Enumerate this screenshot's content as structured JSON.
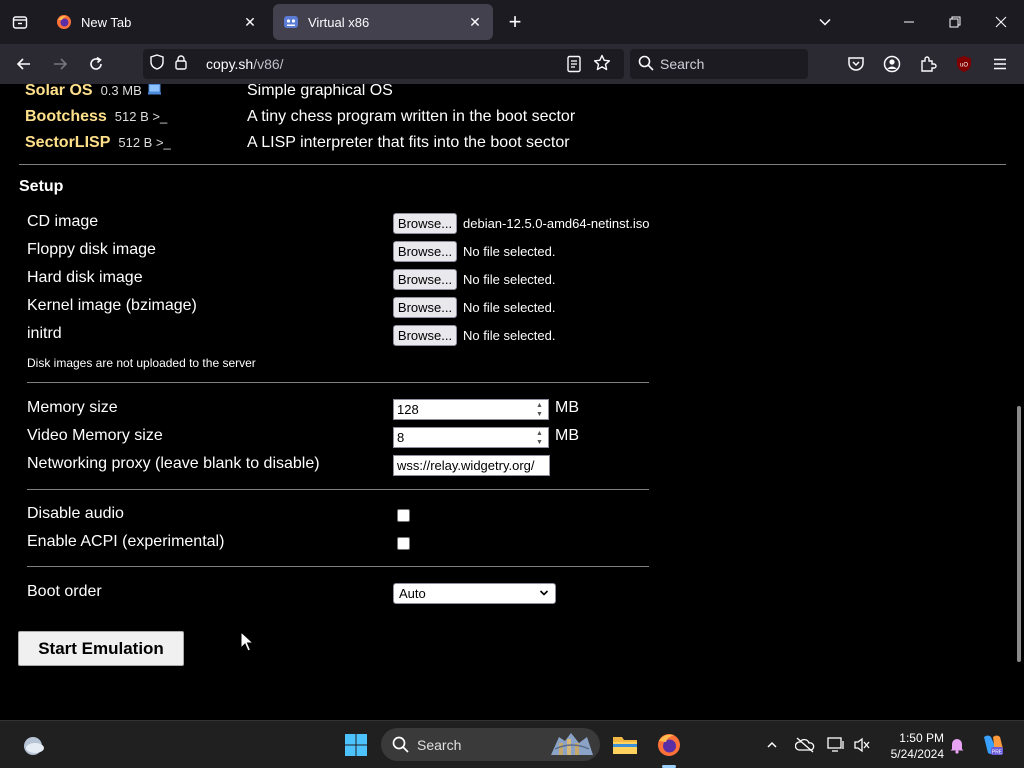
{
  "browser": {
    "tabs": [
      {
        "title": "New Tab",
        "active": false
      },
      {
        "title": "Virtual x86",
        "active": true
      }
    ],
    "url": {
      "host": "copy.sh",
      "path": "/v86/"
    },
    "search_placeholder": "Search"
  },
  "os_list": [
    {
      "name": "Solar OS",
      "size": "0.3 MB",
      "desc": "Simple graphical OS"
    },
    {
      "name": "Bootchess",
      "size": "512 B >_",
      "desc": "A tiny chess program written in the boot sector"
    },
    {
      "name": "SectorLISP",
      "size": "512 B >_",
      "desc": "A LISP interpreter that fits into the boot sector"
    }
  ],
  "setup": {
    "title": "Setup",
    "files": [
      {
        "label": "CD image",
        "button": "Browse...",
        "status": "debian-12.5.0-amd64-netinst.iso"
      },
      {
        "label": "Floppy disk image",
        "button": "Browse...",
        "status": "No file selected."
      },
      {
        "label": "Hard disk image",
        "button": "Browse...",
        "status": "No file selected."
      },
      {
        "label": "Kernel image (bzimage)",
        "button": "Browse...",
        "status": "No file selected."
      },
      {
        "label": "initrd",
        "button": "Browse...",
        "status": "No file selected."
      }
    ],
    "note": "Disk images are not uploaded to the server",
    "memory_label": "Memory size",
    "memory_value": "128",
    "memory_unit": "MB",
    "vram_label": "Video Memory size",
    "vram_value": "8",
    "vram_unit": "MB",
    "proxy_label": "Networking proxy (leave blank to disable)",
    "proxy_value": "wss://relay.widgetry.org/",
    "disable_audio_label": "Disable audio",
    "disable_audio_checked": false,
    "acpi_label": "Enable ACPI (experimental)",
    "acpi_checked": false,
    "boot_order_label": "Boot order",
    "boot_order_value": "Auto",
    "start_button": "Start Emulation"
  },
  "taskbar": {
    "search_label": "Search",
    "time": "1:50 PM",
    "date": "5/24/2024"
  },
  "colors": {
    "os_name": "#ffe08a",
    "tab_active": "#42414d",
    "chrome_bg": "#1c1b22",
    "taskbar_bg": "#202020"
  }
}
